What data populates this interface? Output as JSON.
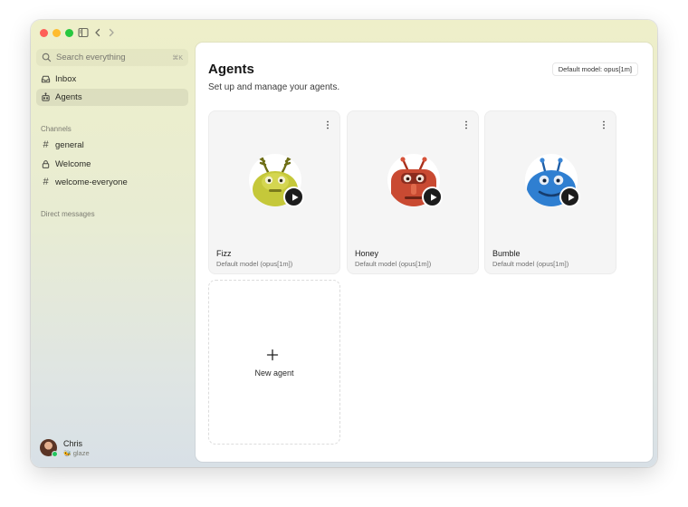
{
  "sidebar": {
    "search": {
      "placeholder": "Search everything",
      "shortcut": "⌘K"
    },
    "nav": [
      {
        "label": "Inbox",
        "icon": "inbox-icon",
        "active": false
      },
      {
        "label": "Agents",
        "icon": "robot-icon",
        "active": true
      }
    ],
    "channels_label": "Channels",
    "channels": [
      {
        "label": "general",
        "icon": "hash-icon"
      },
      {
        "label": "Welcome",
        "icon": "lock-icon"
      },
      {
        "label": "welcome-everyone",
        "icon": "hash-icon"
      }
    ],
    "dm_label": "Direct messages",
    "user": {
      "name": "Chris",
      "status": "glaze",
      "status_emoji": "🐝",
      "presence_color": "#22c55e"
    }
  },
  "main": {
    "title": "Agents",
    "subtitle": "Set up and manage your agents.",
    "default_model_chip": "Default model: opus[1m]",
    "agents": [
      {
        "name": "Fizz",
        "model": "Default model (opus[1m])",
        "color": "#c5c83a",
        "icon": "fizz-avatar-icon"
      },
      {
        "name": "Honey",
        "model": "Default model (opus[1m])",
        "color": "#c94a32",
        "icon": "honey-avatar-icon"
      },
      {
        "name": "Bumble",
        "model": "Default model (opus[1m])",
        "color": "#2f7fd1",
        "icon": "bumble-avatar-icon"
      }
    ],
    "new_agent_label": "New agent"
  },
  "colors": {
    "traffic_red": "#fe5f57",
    "traffic_yellow": "#febc2e",
    "traffic_green": "#28c840",
    "accent_dark": "#1c1c1c"
  }
}
